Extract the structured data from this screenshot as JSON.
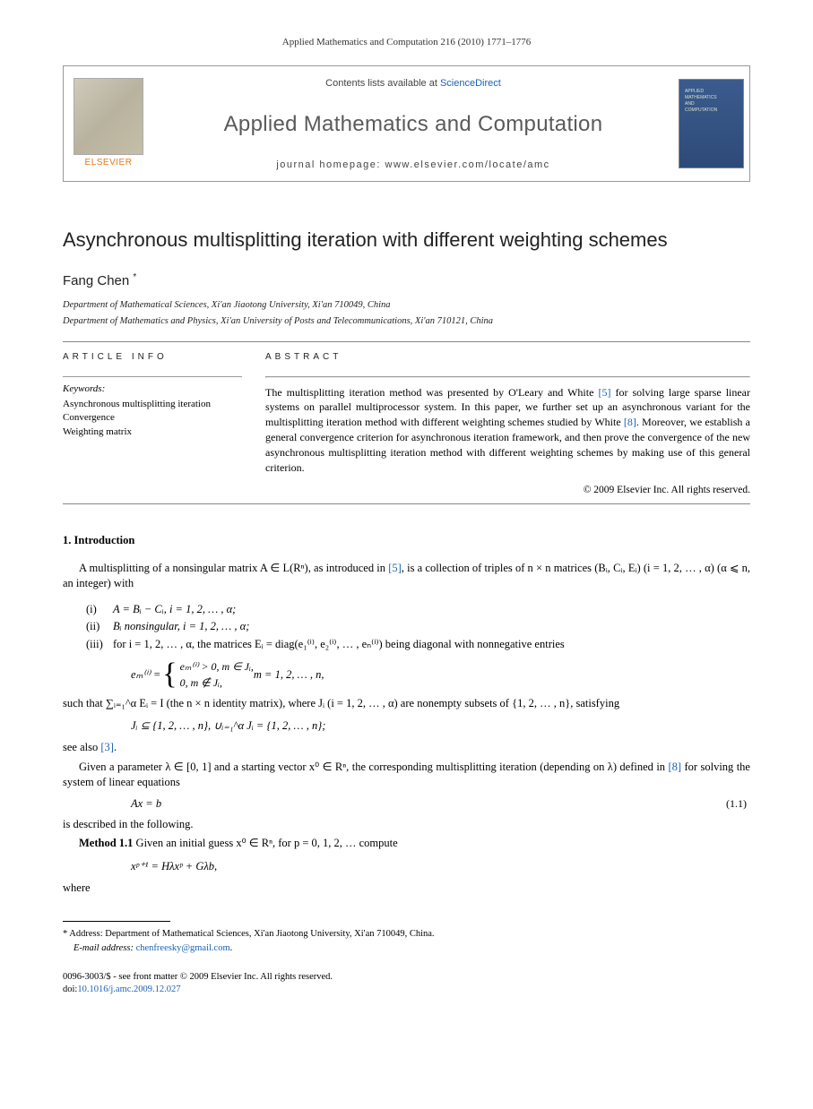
{
  "header": {
    "citation": "Applied Mathematics and Computation 216 (2010) 1771–1776"
  },
  "journal_box": {
    "contents_prefix": "Contents lists available at ",
    "contents_link": "ScienceDirect",
    "journal_name": "Applied Mathematics and Computation",
    "homepage_label": "journal homepage: www.elsevier.com/locate/amc",
    "publisher": "ELSEVIER"
  },
  "article": {
    "title": "Asynchronous multisplitting iteration with different weighting schemes",
    "author": "Fang Chen",
    "author_marker": "*",
    "affiliations": [
      "Department of Mathematical Sciences, Xi'an Jiaotong University, Xi'an 710049, China",
      "Department of Mathematics and Physics, Xi'an University of Posts and Telecommunications, Xi'an 710121, China"
    ]
  },
  "info": {
    "label": "ARTICLE INFO",
    "keywords_label": "Keywords:",
    "keywords": [
      "Asynchronous multisplitting iteration",
      "Convergence",
      "Weighting matrix"
    ]
  },
  "abstract": {
    "label": "ABSTRACT",
    "text_parts": {
      "p1a": "The multisplitting iteration method was presented by O'Leary and White ",
      "ref5": "[5]",
      "p1b": " for solving large sparse linear systems on parallel multiprocessor system. In this paper, we further set up an asynchronous variant for the multisplitting iteration method with different weighting schemes studied by White ",
      "ref8": "[8]",
      "p1c": ". Moreover, we establish a general convergence criterion for asynchronous iteration framework, and then prove the convergence of the new asynchronous multisplitting iteration method with different weighting schemes by making use of this general criterion."
    },
    "copyright": "© 2009 Elsevier Inc. All rights reserved."
  },
  "body": {
    "section1_head": "1. Introduction",
    "p1a": "A multisplitting of a nonsingular matrix A ∈ L(Rⁿ), as introduced in ",
    "p1_ref": "[5]",
    "p1b": ", is a collection of triples of n × n matrices (Bᵢ, Cᵢ, Eᵢ)  (i = 1, 2, … , α)  (α ⩽ n, an integer) with",
    "items": {
      "i_label": "(i)",
      "i_text": "A = Bᵢ − Cᵢ,    i = 1, 2, … , α;",
      "ii_label": "(ii)",
      "ii_text": "Bᵢ nonsingular, i = 1, 2, … , α;",
      "iii_label": "(iii)",
      "iii_text": "for i = 1, 2, … , α, the matrices Eᵢ = diag(e₁⁽ⁱ⁾, e₂⁽ⁱ⁾, … , eₙ⁽ⁱ⁾) being diagonal with nonnegative entries"
    },
    "brace": {
      "lhs": "eₘ⁽ⁱ⁾ = ",
      "row1": "eₘ⁽ⁱ⁾ > 0,   m ∈ Jᵢ,",
      "row2": "0,            m ∉ Jᵢ,",
      "tail": "   m = 1, 2, … , n,"
    },
    "p2a": "such that ∑ᵢ₌₁^α Eᵢ = I (the n × n identity matrix), where Jᵢ (i = 1, 2, … , α) are nonempty subsets of {1, 2, … , n}, satisfying",
    "eq_sets": "Jᵢ ⊆ {1, 2, … , n},    ∪ᵢ₌₁^α Jᵢ = {1, 2, … , n};",
    "p3a": "see also ",
    "p3_ref": "[3]",
    "p3b": ".",
    "p4a": "Given a parameter λ ∈ [0, 1] and a starting vector x⁰ ∈ Rⁿ, the corresponding multisplitting iteration (depending on λ) defined in ",
    "p4_ref": "[8]",
    "p4b": " for solving the system of linear equations",
    "eq11": "Ax = b",
    "eq11_num": "(1.1)",
    "p5": "is described in the following.",
    "method_label": "Method 1.1",
    "method_text": " Given an initial guess x⁰ ∈ Rⁿ, for p = 0, 1, 2, … compute",
    "eq_method": "xᵖ⁺¹ = Hλxᵖ + Gλb,",
    "p6": "where"
  },
  "footnote": {
    "marker": "*",
    "address_label": " Address: ",
    "address": "Department of Mathematical Sciences, Xi'an Jiaotong University, Xi'an 710049, China.",
    "email_label": "E-mail address: ",
    "email": "chenfreesky@gmail.com",
    "email_suffix": "."
  },
  "doc_footer": {
    "line1": "0096-3003/$ - see front matter © 2009 Elsevier Inc. All rights reserved.",
    "doi_label": "doi:",
    "doi": "10.1016/j.amc.2009.12.027"
  }
}
